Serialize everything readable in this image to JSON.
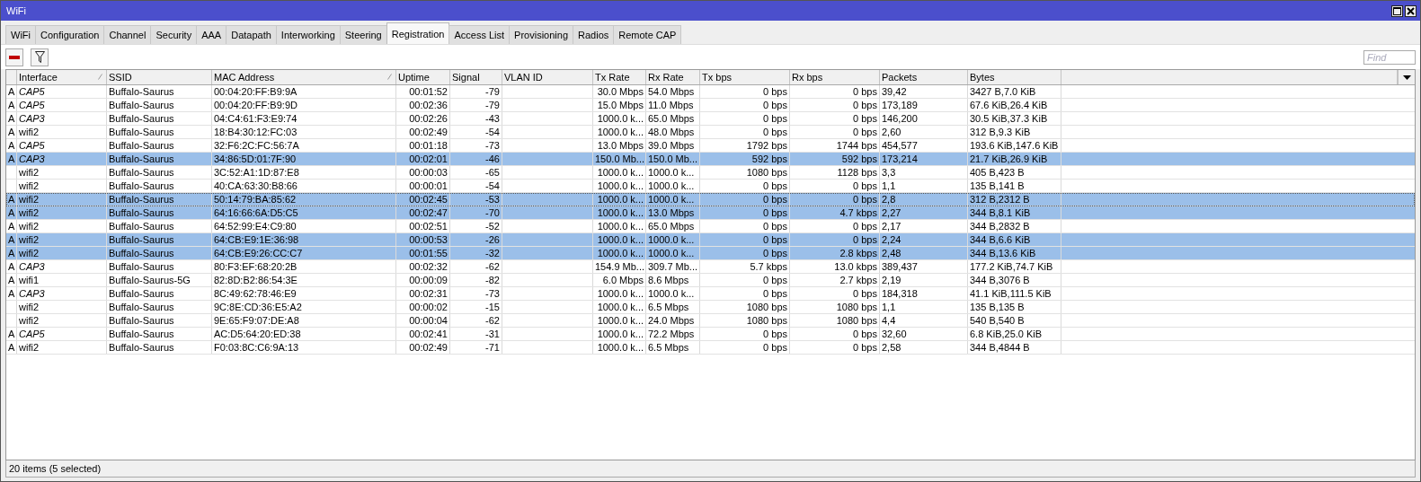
{
  "window": {
    "title": "WiFi"
  },
  "tabs": [
    {
      "label": "WiFi",
      "selected": false
    },
    {
      "label": "Configuration",
      "selected": false
    },
    {
      "label": "Channel",
      "selected": false
    },
    {
      "label": "Security",
      "selected": false
    },
    {
      "label": "AAA",
      "selected": false
    },
    {
      "label": "Datapath",
      "selected": false
    },
    {
      "label": "Interworking",
      "selected": false
    },
    {
      "label": "Steering",
      "selected": false
    },
    {
      "label": "Registration",
      "selected": true
    },
    {
      "label": "Access List",
      "selected": false
    },
    {
      "label": "Provisioning",
      "selected": false
    },
    {
      "label": "Radios",
      "selected": false
    },
    {
      "label": "Remote CAP",
      "selected": false
    }
  ],
  "search": {
    "placeholder": "Find"
  },
  "table": {
    "columns": [
      {
        "label": "Interface",
        "sorted": true
      },
      {
        "label": "SSID",
        "sorted": false
      },
      {
        "label": "MAC Address",
        "sorted": true
      },
      {
        "label": "Uptime",
        "sorted": false
      },
      {
        "label": "Signal",
        "sorted": false
      },
      {
        "label": "VLAN ID",
        "sorted": false
      },
      {
        "label": "Tx Rate",
        "sorted": false
      },
      {
        "label": "Rx Rate",
        "sorted": false
      },
      {
        "label": "Tx bps",
        "sorted": false
      },
      {
        "label": "Rx bps",
        "sorted": false
      },
      {
        "label": "Packets",
        "sorted": false
      },
      {
        "label": "Bytes",
        "sorted": false
      }
    ],
    "rows": [
      {
        "flag": "A",
        "interface": "CAP5",
        "remote": true,
        "ssid": "Buffalo-Saurus",
        "mac": "00:04:20:FF:B9:9A",
        "uptime": "00:01:52",
        "signal": "-79",
        "tx_rate": "30.0 Mbps",
        "rx_rate": "54.0 Mbps",
        "tx_bps": "0 bps",
        "rx_bps": "0 bps",
        "packets": "39,42",
        "bytes": "3427 B,7.0 KiB",
        "selected": false,
        "focused": false
      },
      {
        "flag": "A",
        "interface": "CAP5",
        "remote": true,
        "ssid": "Buffalo-Saurus",
        "mac": "00:04:20:FF:B9:9D",
        "uptime": "00:02:36",
        "signal": "-79",
        "tx_rate": "15.0 Mbps",
        "rx_rate": "11.0 Mbps",
        "tx_bps": "0 bps",
        "rx_bps": "0 bps",
        "packets": "173,189",
        "bytes": "67.6 KiB,26.4 KiB",
        "selected": false,
        "focused": false
      },
      {
        "flag": "A",
        "interface": "CAP3",
        "remote": true,
        "ssid": "Buffalo-Saurus",
        "mac": "04:C4:61:F3:E9:74",
        "uptime": "00:02:26",
        "signal": "-43",
        "tx_rate": "1000.0 k...",
        "rx_rate": "65.0 Mbps",
        "tx_bps": "0 bps",
        "rx_bps": "0 bps",
        "packets": "146,200",
        "bytes": "30.5 KiB,37.3 KiB",
        "selected": false,
        "focused": false
      },
      {
        "flag": "A",
        "interface": "wifi2",
        "remote": false,
        "ssid": "Buffalo-Saurus",
        "mac": "18:B4:30:12:FC:03",
        "uptime": "00:02:49",
        "signal": "-54",
        "tx_rate": "1000.0 k...",
        "rx_rate": "48.0 Mbps",
        "tx_bps": "0 bps",
        "rx_bps": "0 bps",
        "packets": "2,60",
        "bytes": "312 B,9.3 KiB",
        "selected": false,
        "focused": false
      },
      {
        "flag": "A",
        "interface": "CAP5",
        "remote": true,
        "ssid": "Buffalo-Saurus",
        "mac": "32:F6:2C:FC:56:7A",
        "uptime": "00:01:18",
        "signal": "-73",
        "tx_rate": "13.0 Mbps",
        "rx_rate": "39.0 Mbps",
        "tx_bps": "1792 bps",
        "rx_bps": "1744 bps",
        "packets": "454,577",
        "bytes": "193.6 KiB,147.6 KiB",
        "selected": false,
        "focused": false
      },
      {
        "flag": "A",
        "interface": "CAP3",
        "remote": true,
        "ssid": "Buffalo-Saurus",
        "mac": "34:86:5D:01:7F:90",
        "uptime": "00:02:01",
        "signal": "-46",
        "tx_rate": "150.0 Mb...",
        "rx_rate": "150.0 Mb...",
        "tx_bps": "592 bps",
        "rx_bps": "592 bps",
        "packets": "173,214",
        "bytes": "21.7 KiB,26.9 KiB",
        "selected": true,
        "focused": false
      },
      {
        "interface": "wifi2",
        "remote": false,
        "ssid": "Buffalo-Saurus",
        "mac": "3C:52:A1:1D:87:E8",
        "uptime": "00:00:03",
        "signal": "-65",
        "tx_rate": "1000.0 k...",
        "rx_rate": "1000.0 k...",
        "tx_bps": "1080 bps",
        "rx_bps": "1128 bps",
        "packets": "3,3",
        "bytes": "405 B,423 B",
        "selected": false,
        "focused": false
      },
      {
        "interface": "wifi2",
        "remote": false,
        "ssid": "Buffalo-Saurus",
        "mac": "40:CA:63:30:B8:66",
        "uptime": "00:00:01",
        "signal": "-54",
        "tx_rate": "1000.0 k...",
        "rx_rate": "1000.0 k...",
        "tx_bps": "0 bps",
        "rx_bps": "0 bps",
        "packets": "1,1",
        "bytes": "135 B,141 B",
        "selected": false,
        "focused": false
      },
      {
        "flag": "A",
        "interface": "wifi2",
        "remote": false,
        "ssid": "Buffalo-Saurus",
        "mac": "50:14:79:BA:85:62",
        "uptime": "00:02:45",
        "signal": "-53",
        "tx_rate": "1000.0 k...",
        "rx_rate": "1000.0 k...",
        "tx_bps": "0 bps",
        "rx_bps": "0 bps",
        "packets": "2,8",
        "bytes": "312 B,2312 B",
        "selected": true,
        "focused": true
      },
      {
        "flag": "A",
        "interface": "wifi2",
        "remote": false,
        "ssid": "Buffalo-Saurus",
        "mac": "64:16:66:6A:D5:C5",
        "uptime": "00:02:47",
        "signal": "-70",
        "tx_rate": "1000.0 k...",
        "rx_rate": "13.0 Mbps",
        "tx_bps": "0 bps",
        "rx_bps": "4.7 kbps",
        "packets": "2,27",
        "bytes": "344 B,8.1 KiB",
        "selected": true,
        "focused": false
      },
      {
        "flag": "A",
        "interface": "wifi2",
        "remote": false,
        "ssid": "Buffalo-Saurus",
        "mac": "64:52:99:E4:C9:80",
        "uptime": "00:02:51",
        "signal": "-52",
        "tx_rate": "1000.0 k...",
        "rx_rate": "65.0 Mbps",
        "tx_bps": "0 bps",
        "rx_bps": "0 bps",
        "packets": "2,17",
        "bytes": "344 B,2832 B",
        "selected": false,
        "focused": false
      },
      {
        "flag": "A",
        "interface": "wifi2",
        "remote": false,
        "ssid": "Buffalo-Saurus",
        "mac": "64:CB:E9:1E:36:98",
        "uptime": "00:00:53",
        "signal": "-26",
        "tx_rate": "1000.0 k...",
        "rx_rate": "1000.0 k...",
        "tx_bps": "0 bps",
        "rx_bps": "0 bps",
        "packets": "2,24",
        "bytes": "344 B,6.6 KiB",
        "selected": true,
        "focused": false
      },
      {
        "flag": "A",
        "interface": "wifi2",
        "remote": false,
        "ssid": "Buffalo-Saurus",
        "mac": "64:CB:E9:26:CC:C7",
        "uptime": "00:01:55",
        "signal": "-32",
        "tx_rate": "1000.0 k...",
        "rx_rate": "1000.0 k...",
        "tx_bps": "0 bps",
        "rx_bps": "2.8 kbps",
        "packets": "2,48",
        "bytes": "344 B,13.6 KiB",
        "selected": true,
        "focused": false
      },
      {
        "flag": "A",
        "interface": "CAP3",
        "remote": true,
        "ssid": "Buffalo-Saurus",
        "mac": "80:F3:EF:68:20:2B",
        "uptime": "00:02:32",
        "signal": "-62",
        "tx_rate": "154.9 Mb...",
        "rx_rate": "309.7 Mb...",
        "tx_bps": "5.7 kbps",
        "rx_bps": "13.0 kbps",
        "packets": "389,437",
        "bytes": "177.2 KiB,74.7 KiB",
        "selected": false,
        "focused": false
      },
      {
        "flag": "A",
        "interface": "wifi1",
        "remote": false,
        "ssid": "Buffalo-Saurus-5G",
        "mac": "82:8D:B2:86:54:3E",
        "uptime": "00:00:09",
        "signal": "-82",
        "tx_rate": "6.0 Mbps",
        "rx_rate": "8.6 Mbps",
        "tx_bps": "0 bps",
        "rx_bps": "2.7 kbps",
        "packets": "2,19",
        "bytes": "344 B,3076 B",
        "selected": false,
        "focused": false
      },
      {
        "flag": "A",
        "interface": "CAP3",
        "remote": true,
        "ssid": "Buffalo-Saurus",
        "mac": "8C:49:62:78:46:E9",
        "uptime": "00:02:31",
        "signal": "-73",
        "tx_rate": "1000.0 k...",
        "rx_rate": "1000.0 k...",
        "tx_bps": "0 bps",
        "rx_bps": "0 bps",
        "packets": "184,318",
        "bytes": "41.1 KiB,111.5 KiB",
        "selected": false,
        "focused": false
      },
      {
        "interface": "wifi2",
        "remote": false,
        "ssid": "Buffalo-Saurus",
        "mac": "9C:8E:CD:36:E5:A2",
        "uptime": "00:00:02",
        "signal": "-15",
        "tx_rate": "1000.0 k...",
        "rx_rate": "6.5 Mbps",
        "tx_bps": "1080 bps",
        "rx_bps": "1080 bps",
        "packets": "1,1",
        "bytes": "135 B,135 B",
        "selected": false,
        "focused": false
      },
      {
        "interface": "wifi2",
        "remote": false,
        "ssid": "Buffalo-Saurus",
        "mac": "9E:65:F9:07:DE:A8",
        "uptime": "00:00:04",
        "signal": "-62",
        "tx_rate": "1000.0 k...",
        "rx_rate": "24.0 Mbps",
        "tx_bps": "1080 bps",
        "rx_bps": "1080 bps",
        "packets": "4,4",
        "bytes": "540 B,540 B",
        "selected": false,
        "focused": false
      },
      {
        "flag": "A",
        "interface": "CAP5",
        "remote": true,
        "ssid": "Buffalo-Saurus",
        "mac": "AC:D5:64:20:ED:38",
        "uptime": "00:02:41",
        "signal": "-31",
        "tx_rate": "1000.0 k...",
        "rx_rate": "72.2 Mbps",
        "tx_bps": "0 bps",
        "rx_bps": "0 bps",
        "packets": "32,60",
        "bytes": "6.8 KiB,25.0 KiB",
        "selected": false,
        "focused": false
      },
      {
        "flag": "A",
        "interface": "wifi2",
        "remote": false,
        "ssid": "Buffalo-Saurus",
        "mac": "F0:03:8C:C6:9A:13",
        "uptime": "00:02:49",
        "signal": "-71",
        "tx_rate": "1000.0 k...",
        "rx_rate": "6.5 Mbps",
        "tx_bps": "0 bps",
        "rx_bps": "0 bps",
        "packets": "2,58",
        "bytes": "344 B,4844 B",
        "selected": false,
        "focused": false
      }
    ]
  },
  "status_bar": {
    "text": "20 items (5 selected)"
  }
}
